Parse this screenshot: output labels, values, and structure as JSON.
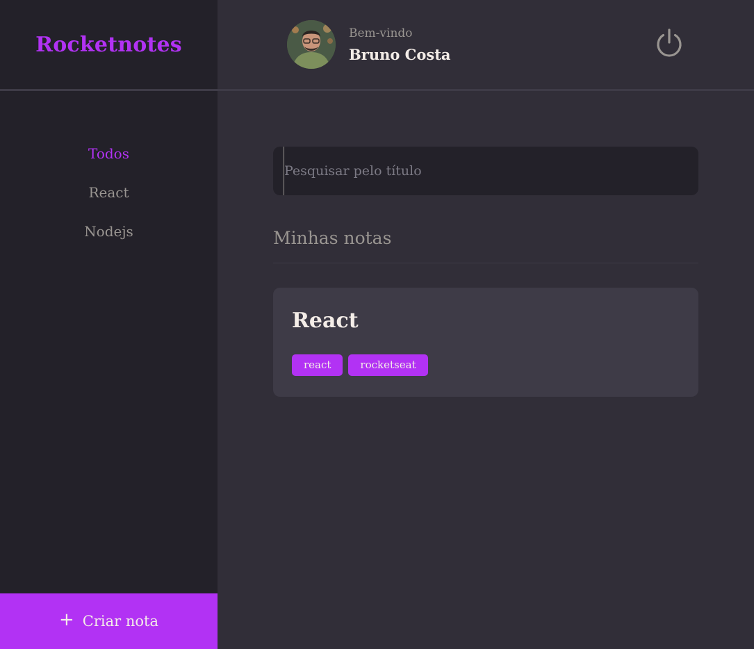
{
  "brand": {
    "title": "Rocketnotes"
  },
  "header": {
    "welcome_label": "Bem-vindo",
    "user_name": "Bruno Costa",
    "logout_icon": "power-icon"
  },
  "sidebar": {
    "tags": [
      {
        "label": "Todos",
        "active": true
      },
      {
        "label": "React",
        "active": false
      },
      {
        "label": "Nodejs",
        "active": false
      }
    ],
    "new_note": {
      "label": "Criar nota",
      "icon": "plus-icon"
    }
  },
  "search": {
    "placeholder": "Pesquisar pelo título",
    "value": ""
  },
  "notes_section": {
    "title": "Minhas notas",
    "notes": [
      {
        "title": "React",
        "tags": [
          "react",
          "rocketseat"
        ]
      }
    ]
  },
  "colors": {
    "accent": "#B232F4",
    "background": "#312E38",
    "sidebar": "#232129",
    "card": "#3E3B47",
    "text_light": "#F4EDE8",
    "text_muted": "#999591"
  }
}
